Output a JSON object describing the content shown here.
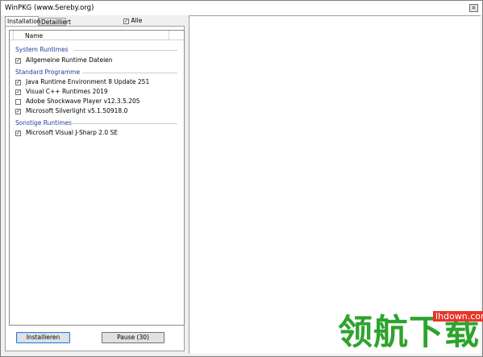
{
  "window": {
    "title": "WinPKG (www.Sereby.org)",
    "close_glyph": "×"
  },
  "tabs": [
    {
      "label": "Installation",
      "active": true
    },
    {
      "label": "Detailliert",
      "active": false
    }
  ],
  "select_all": {
    "label": "Alle",
    "checked": true
  },
  "list": {
    "column_header": "Name",
    "groups": [
      {
        "title": "System Runtimes",
        "items": [
          {
            "label": "Allgemeine Runtime Dateien",
            "checked": true
          }
        ]
      },
      {
        "title": "Standard Programme",
        "items": [
          {
            "label": "Java Runtime Environment 8 Update 251",
            "checked": true
          },
          {
            "label": "Visual C++ Runtimes 2019",
            "checked": true
          },
          {
            "label": "Adobe Shockwave Player v12.3.5.205",
            "checked": false
          },
          {
            "label": "Microsoft Silverlight v5.1.50918.0",
            "checked": true
          }
        ]
      },
      {
        "title": "Sonstige Runtimes",
        "items": [
          {
            "label": "Microsoft Visual J-Sharp 2.0 SE",
            "checked": true
          }
        ]
      }
    ]
  },
  "buttons": {
    "install": "Installieren",
    "pause": "Pause (30)"
  },
  "watermark": {
    "text": "领航下载",
    "url": "lhdown.com"
  },
  "colors": {
    "group_heading": "#1e3f9e",
    "accent_focus": "#2a7bd5",
    "watermark_green": "#2ea32e",
    "watermark_red": "#e8362a"
  },
  "check_glyph": "✓"
}
